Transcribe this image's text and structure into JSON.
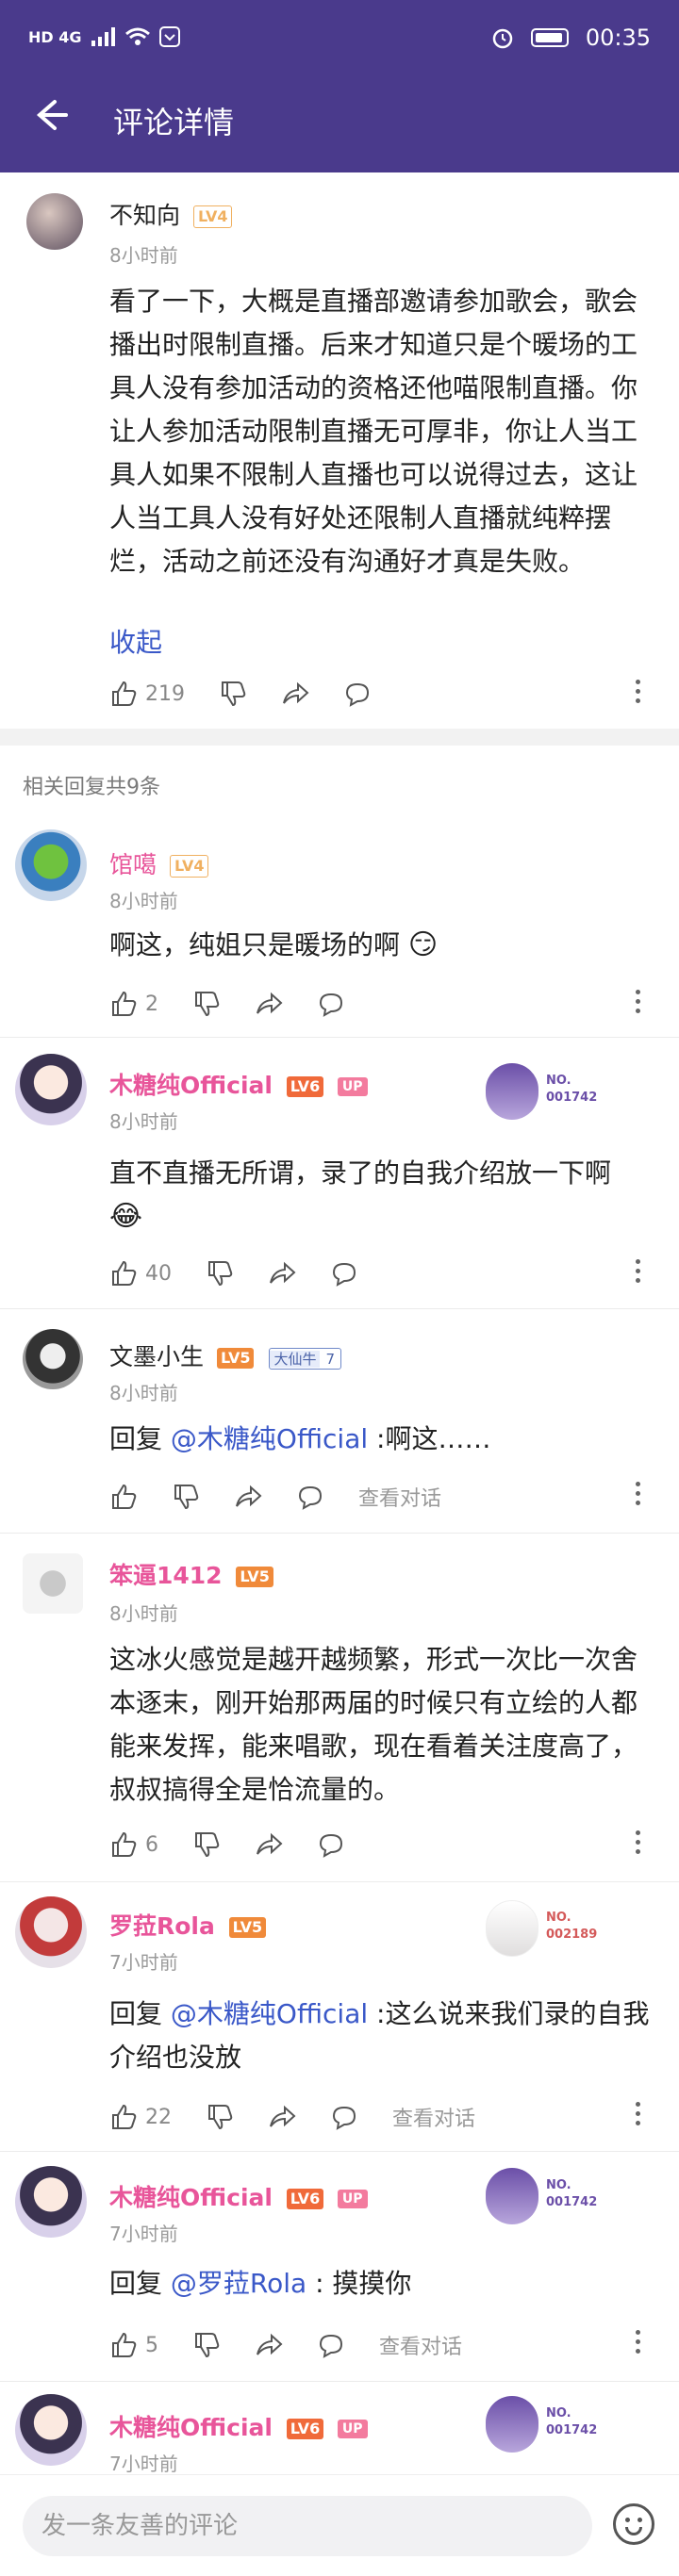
{
  "status_bar": {
    "network": "HD 4G",
    "time": "00:35"
  },
  "header": {
    "title": "评论详情"
  },
  "main_comment": {
    "user": "不知向",
    "level": "LV4",
    "time": "8小时前",
    "text": "看了一下，大概是直播部邀请参加歌会，歌会播出时限制直播。后来才知道只是个暖场的工具人没有参加活动的资格还他喵限制直播。你让人参加活动限制直播无可厚非，你让人当工具人如果不限制人直播也可以说得过去，这让人当工具人没有好处还限制人直播就纯粹摆烂，活动之前还没有沟通好才真是失败。",
    "collapse": "收起",
    "likes": "219"
  },
  "replies_header": "相关回复共9条",
  "replies": [
    {
      "user": "馆噶",
      "level": "LV4",
      "time": "8小时前",
      "text": "啊这，纯姐只是暖场的啊",
      "likes": "2"
    },
    {
      "user": "木糖纯Official",
      "level": "LV6",
      "badge": "UP",
      "card_no": "NO.\n001742",
      "time": "8小时前",
      "text": "直不直播无所谓，录了的自我介绍放一下啊",
      "likes": "40"
    },
    {
      "user": "文墨小生",
      "level": "LV5",
      "fan_name": "大仙牛",
      "fan_level": "7",
      "time": "8小时前",
      "reply_prefix": "回复 ",
      "mention": "@木糖纯Official",
      "text": " :啊这……",
      "view_conv": "查看对话"
    },
    {
      "user": "笨逼1412",
      "level": "LV5",
      "time": "8小时前",
      "text": "这冰火感觉是越开越频繁，形式一次比一次舍本逐末，刚开始那两届的时候只有立绘的人都能来发挥，能来唱歌，现在看着关注度高了，叔叔搞得全是恰流量的。",
      "likes": "6"
    },
    {
      "user": "罗菈Rola",
      "level": "LV5",
      "card_no": "NO.\n002189",
      "time": "7小时前",
      "reply_prefix": "回复 ",
      "mention": "@木糖纯Official",
      "text": " :这么说来我们录的自我介绍也没放",
      "likes": "22",
      "view_conv": "查看对话"
    },
    {
      "user": "木糖纯Official",
      "level": "LV6",
      "badge": "UP",
      "card_no": "NO.\n001742",
      "time": "7小时前",
      "reply_prefix": "回复 ",
      "mention": "@罗菈Rola",
      "text": " :  摸摸你",
      "likes": "5",
      "view_conv": "查看对话"
    },
    {
      "user": "木糖纯Official",
      "level": "LV6",
      "badge": "UP",
      "card_no": "NO.\n001742",
      "time": "7小时前"
    }
  ],
  "composer": {
    "placeholder": "发一条友善的评论"
  },
  "colors": {
    "header_bg": "#4a3a8c",
    "name_pink": "#e8559a",
    "mention_blue": "#3a58c8"
  }
}
